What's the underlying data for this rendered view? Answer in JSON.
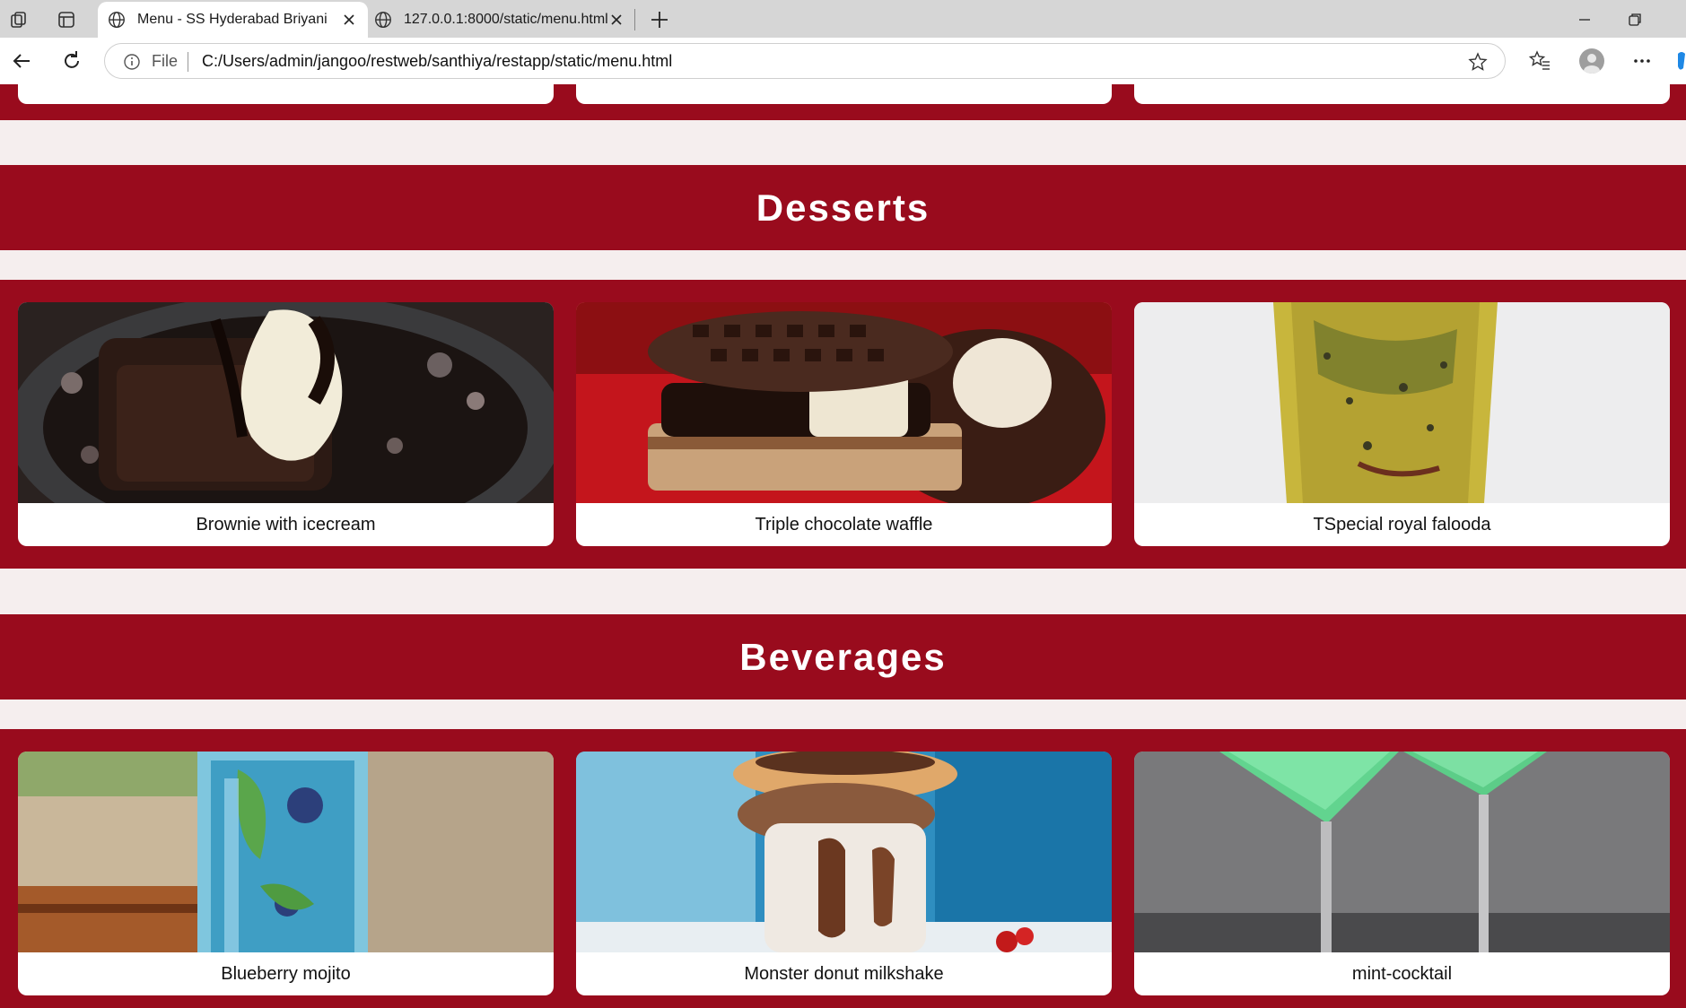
{
  "browser": {
    "tabs": [
      {
        "title": "Menu - SS Hyderabad Briyani",
        "active": true
      },
      {
        "title": "127.0.0.1:8000/static/menu.html",
        "active": false
      }
    ],
    "address": {
      "scheme_label": "File",
      "url": "C:/Users/admin/jangoo/restweb/santhiya/restapp/static/menu.html"
    }
  },
  "sections": [
    {
      "title": "Desserts",
      "items": [
        {
          "name": "Brownie with icecream"
        },
        {
          "name": "Triple chocolate waffle"
        },
        {
          "name": "TSpecial royal falooda"
        }
      ]
    },
    {
      "title": "Beverages",
      "items": [
        {
          "name": "Blueberry mojito"
        },
        {
          "name": "Monster donut milkshake"
        },
        {
          "name": "mint-cocktail"
        }
      ]
    }
  ],
  "colors": {
    "accent": "#990b1d",
    "page_background": "#f5eeee",
    "card_background": "#ffffff"
  }
}
